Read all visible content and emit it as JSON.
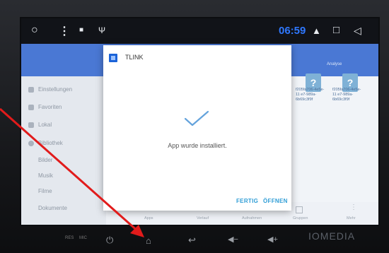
{
  "statusbar": {
    "time": "06:59"
  },
  "sidebar": {
    "items": [
      {
        "label": "Einstellungen"
      },
      {
        "label": "Favoriten"
      },
      {
        "label": "Lokal"
      },
      {
        "label": "Bibliothek"
      },
      {
        "label": "Bilder"
      },
      {
        "label": "Musik"
      },
      {
        "label": "Filme"
      },
      {
        "label": "Dokumente"
      }
    ]
  },
  "main": {
    "analyse_label": "Analyse",
    "files": [
      {
        "name": "f205fa706-4e5e-11 e7-989a-6b69c3f9f"
      },
      {
        "name": "f205fa706-4e5e-11 e7-989a-6b69c3f9f"
      }
    ],
    "bottom_labels": [
      "Apps",
      "Verlauf",
      "Aufnahmen",
      "Gruppen",
      "Mehr"
    ]
  },
  "dialog": {
    "app_name": "TLINK",
    "message": "App wurde installiert.",
    "done_label": "FERTIG",
    "open_label": "ÖFFNEN"
  },
  "hardware": {
    "res_label": "RES",
    "mic_label": "MIC",
    "brand": "IOMEDIA"
  }
}
